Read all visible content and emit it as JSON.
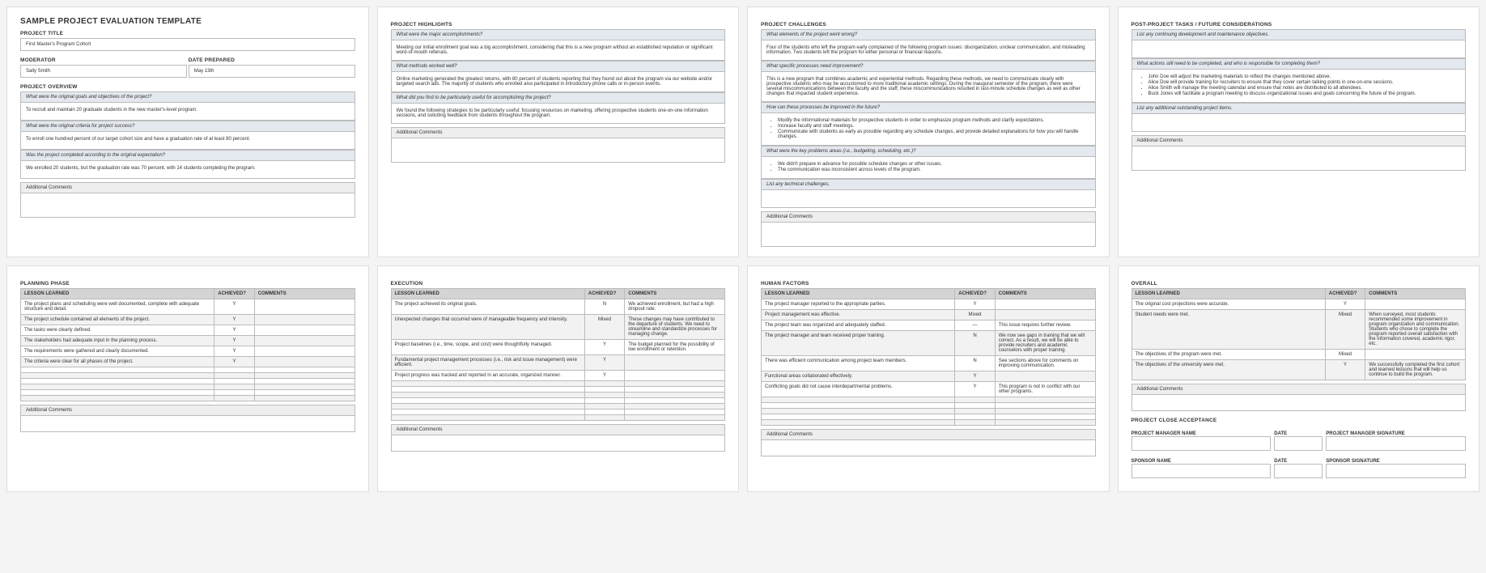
{
  "doc_title": "SAMPLE PROJECT EVALUATION TEMPLATE",
  "labels": {
    "project_title": "PROJECT TITLE",
    "moderator": "MODERATOR",
    "date_prepared": "DATE PREPARED",
    "addl_comments": "Additional Comments"
  },
  "header": {
    "project_title": "First Master's Program Cohort",
    "moderator": "Sally Smith",
    "date_prepared": "May 13th"
  },
  "sections": {
    "overview": {
      "heading": "PROJECT OVERVIEW",
      "qa": [
        {
          "q": "What were the original goals and objectives of the project?",
          "a": "To recruit and maintain 20 graduate students in the new master's-level program."
        },
        {
          "q": "What were the original criteria for project success?",
          "a": "To enroll one hundred percent of our target cohort size and have a graduation rate of at least 80 percent."
        },
        {
          "q": "Was the project completed according to the original expectation?",
          "a": "We enrolled 20 students, but the graduation rate was 70 percent, with 14 students completing the program."
        }
      ]
    },
    "highlights": {
      "heading": "PROJECT HIGHLIGHTS",
      "qa": [
        {
          "q": "What were the major accomplishments?",
          "a": "Meeting our initial enrollment goal was a big accomplishment, considering that this is a new program without an established reputation or significant word-of-mouth referrals."
        },
        {
          "q": "What methods worked well?",
          "a": "Online marketing generated the greatest returns, with 80 percent of students reporting that they found out about the program via our website and/or targeted search ads. The majority of students who enrolled also participated in introductory phone calls or in-person events."
        },
        {
          "q": "What did you find to be particularly useful for accomplishing the project?",
          "a": "We found the following strategies to be particularly useful: focusing resources on marketing, offering prospective students one-on-one information sessions, and soliciting feedback from students throughout the program."
        }
      ]
    },
    "challenges": {
      "heading": "PROJECT CHALLENGES",
      "qa": [
        {
          "q": "What elements of the project went wrong?",
          "a": "Four of the students who left the program early complained of the following program issues: disorganization, unclear communication, and misleading information. Two students left the program for either personal or financial reasons."
        },
        {
          "q": "What specific processes need improvement?",
          "a": "This is a new program that combines academic and experiential methods. Regarding these methods, we need to communicate clearly with prospective students who may be accustomed to more traditional academic settings. During the inaugural semester of the program, there were several miscommunications between the faculty and the staff; these miscommunications resulted in last-minute schedule changes as well as other changes that impacted student experience."
        },
        {
          "q": "How can these processes be improved in the future?",
          "list": [
            "Modify the informational materials for prospective students in order to emphasize program methods and clarify expectations.",
            "Increase faculty and staff meetings.",
            "Communicate with students as early as possible regarding any schedule changes, and provide detailed explanations for how you will handle changes."
          ]
        },
        {
          "q": "What were the key problems areas (i.e., budgeting, scheduling, etc.)?",
          "list": [
            "We didn't prepare in advance for possible schedule changes or other issues.",
            "The communication was inconsistent across levels of the program."
          ]
        },
        {
          "q": "List any technical challenges.",
          "a": ""
        }
      ]
    },
    "postproject": {
      "heading": "POST-PROJECT TASKS / FUTURE CONSIDERATIONS",
      "qa": [
        {
          "q": "List any continuing development and maintenance objectives.",
          "a": ""
        },
        {
          "q": "What actions still need to be completed, and who is responsible for completing them?",
          "list": [
            "John Doe will adjust the marketing materials to reflect the changes mentioned above.",
            "Alice Doe will provide training for recruiters to ensure that they cover certain talking points in one-on-one sessions.",
            "Alice Smith will manage the meeting calendar and ensure that notes are distributed to all attendees.",
            "Buck Jones will facilitate a program meeting to discuss organizational issues and goals concerning the future of the program."
          ]
        },
        {
          "q": "List any additional outstanding project items.",
          "a": ""
        }
      ]
    }
  },
  "lessons_header": {
    "col1": "LESSON LEARNED",
    "col2": "ACHIEVED?",
    "col3": "COMMENTS"
  },
  "lessons": {
    "planning": {
      "heading": "PLANNING PHASE",
      "rows": [
        {
          "l": "The project plans and scheduling were well documented, complete with adequate structure and detail.",
          "a": "Y",
          "c": ""
        },
        {
          "l": "The project schedule contained all elements of the project.",
          "a": "Y",
          "c": ""
        },
        {
          "l": "The tasks were clearly defined.",
          "a": "Y",
          "c": ""
        },
        {
          "l": "The stakeholders had adequate input in the planning process.",
          "a": "Y",
          "c": ""
        },
        {
          "l": "The requirements were gathered and clearly documented.",
          "a": "Y",
          "c": ""
        },
        {
          "l": "The criteria were clear for all phases of the project.",
          "a": "Y",
          "c": ""
        },
        {
          "l": "",
          "a": "",
          "c": ""
        },
        {
          "l": "",
          "a": "",
          "c": ""
        },
        {
          "l": "",
          "a": "",
          "c": ""
        },
        {
          "l": "",
          "a": "",
          "c": ""
        },
        {
          "l": "",
          "a": "",
          "c": ""
        },
        {
          "l": "",
          "a": "",
          "c": ""
        }
      ]
    },
    "execution": {
      "heading": "EXECUTION",
      "rows": [
        {
          "l": "The project achieved its original goals.",
          "a": "N",
          "c": "We achieved enrollment, but had a high dropout rate."
        },
        {
          "l": "Unexpected changes that occurred were of manageable frequency and intensity.",
          "a": "Mixed",
          "c": "These changes may have contributed to the departure of students. We need to streamline and standardize processes for managing change."
        },
        {
          "l": "Project baselines (i.e., time, scope, and cost) were thoughtfully managed.",
          "a": "Y",
          "c": "The budget planned for the possibility of low enrollment or retention."
        },
        {
          "l": "Fundamental project management processes (i.e., risk and issue management) were efficient.",
          "a": "Y",
          "c": ""
        },
        {
          "l": "Project progress was tracked and reported in an accurate, organized manner.",
          "a": "Y",
          "c": ""
        },
        {
          "l": "",
          "a": "",
          "c": ""
        },
        {
          "l": "",
          "a": "",
          "c": ""
        },
        {
          "l": "",
          "a": "",
          "c": ""
        },
        {
          "l": "",
          "a": "",
          "c": ""
        },
        {
          "l": "",
          "a": "",
          "c": ""
        },
        {
          "l": "",
          "a": "",
          "c": ""
        },
        {
          "l": "",
          "a": "",
          "c": ""
        }
      ]
    },
    "human": {
      "heading": "HUMAN FACTORS",
      "rows": [
        {
          "l": "The project manager reported to the appropriate parties.",
          "a": "Y",
          "c": ""
        },
        {
          "l": "Project management was effective.",
          "a": "Mixed",
          "c": ""
        },
        {
          "l": "The project team was organized and adequately staffed.",
          "a": "—",
          "c": "This issue requires further review."
        },
        {
          "l": "The project manager and team received proper training.",
          "a": "N",
          "c": "We now see gaps in training that we will correct. As a result, we will be able to provide recruiters and academic counselors with proper training."
        },
        {
          "l": "There was efficient communication among project team members.",
          "a": "N",
          "c": "See sections above for comments on improving communication."
        },
        {
          "l": "Functional areas collaborated effectively.",
          "a": "Y",
          "c": ""
        },
        {
          "l": "Conflicting goals did not cause interdepartmental problems.",
          "a": "Y",
          "c": "This program is not in conflict with our other programs."
        },
        {
          "l": "",
          "a": "",
          "c": ""
        },
        {
          "l": "",
          "a": "",
          "c": ""
        },
        {
          "l": "",
          "a": "",
          "c": ""
        },
        {
          "l": "",
          "a": "",
          "c": ""
        },
        {
          "l": "",
          "a": "",
          "c": ""
        }
      ]
    },
    "overall": {
      "heading": "OVERALL",
      "rows": [
        {
          "l": "The original cost projections were accurate.",
          "a": "Y",
          "c": ""
        },
        {
          "l": "Student needs were met.",
          "a": "Mixed",
          "c": "When surveyed, most students recommended some improvement in program organization and communication. Students who chose to complete the program reported overall satisfaction with the information covered, academic rigor, etc."
        },
        {
          "l": "The objectives of the program were met.",
          "a": "Mixed",
          "c": ""
        },
        {
          "l": "The objectives of the university were met.",
          "a": "Y",
          "c": "We successfully completed the first cohort and learned lessons that will help us continue to build the program."
        }
      ]
    }
  },
  "closure": {
    "heading": "PROJECT CLOSE ACCEPTANCE",
    "pm_name": "PROJECT MANAGER NAME",
    "pm_sig": "PROJECT MANAGER SIGNATURE",
    "sp_name": "SPONSOR NAME",
    "sp_sig": "SPONSOR SIGNATURE",
    "date": "DATE"
  }
}
